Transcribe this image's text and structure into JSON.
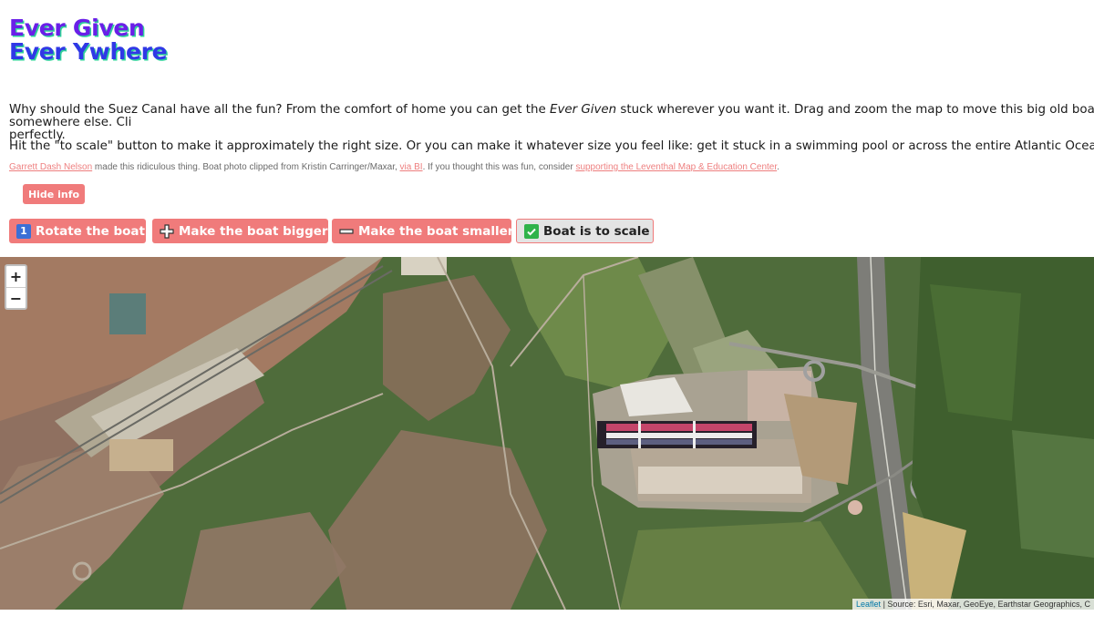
{
  "title": {
    "line1": "Ever Given",
    "line2": "Ever Ywhere"
  },
  "intro": {
    "p1_before": "Why should the Suez Canal have all the fun? From the comfort of home you can get the ",
    "p1_em": "Ever Given",
    "p1_after": " stuck wherever you want it. Drag and zoom the map to move this big old boat somewhere else. Cli",
    "p1_line2": "perfectly.",
    "p2": "Hit the \"to scale\" button to make it approximately the right size. Or you can make it whatever size you feel like: get it stuck in a swimming pool or across the entire Atlantic Ocean."
  },
  "credits": {
    "author_link": "Garrett Dash Nelson",
    "text1": " made this ridiculous thing. Boat photo clipped from Kristin Carringer/Maxar, ",
    "via_link": "via BI",
    "text2": ". If you thought this was fun, consider ",
    "support_link": "supporting the Leventhal Map & Education Center",
    "text3": "."
  },
  "hide_info_label": "Hide info",
  "toolbar": {
    "rotate_icon": "1",
    "rotate_label": "Rotate the boat",
    "bigger_label": "Make the boat bigger",
    "smaller_label": "Make the boat smaller",
    "scale_label": "Boat is to scale"
  },
  "map": {
    "zoom_in": "+",
    "zoom_out": "−",
    "attribution_link": "Leaflet",
    "attribution_text": " | Source: Esri, Maxar, GeoEye, Earthstar Geographics, C"
  },
  "colors": {
    "accent": "#f07b7b",
    "title_purple": "#6a1fe8",
    "title_blue": "#3038e6",
    "title_shadow": "#2fd39a"
  },
  "icons": [
    "info-number-icon",
    "plus-icon",
    "minus-icon",
    "checkmark-icon"
  ]
}
